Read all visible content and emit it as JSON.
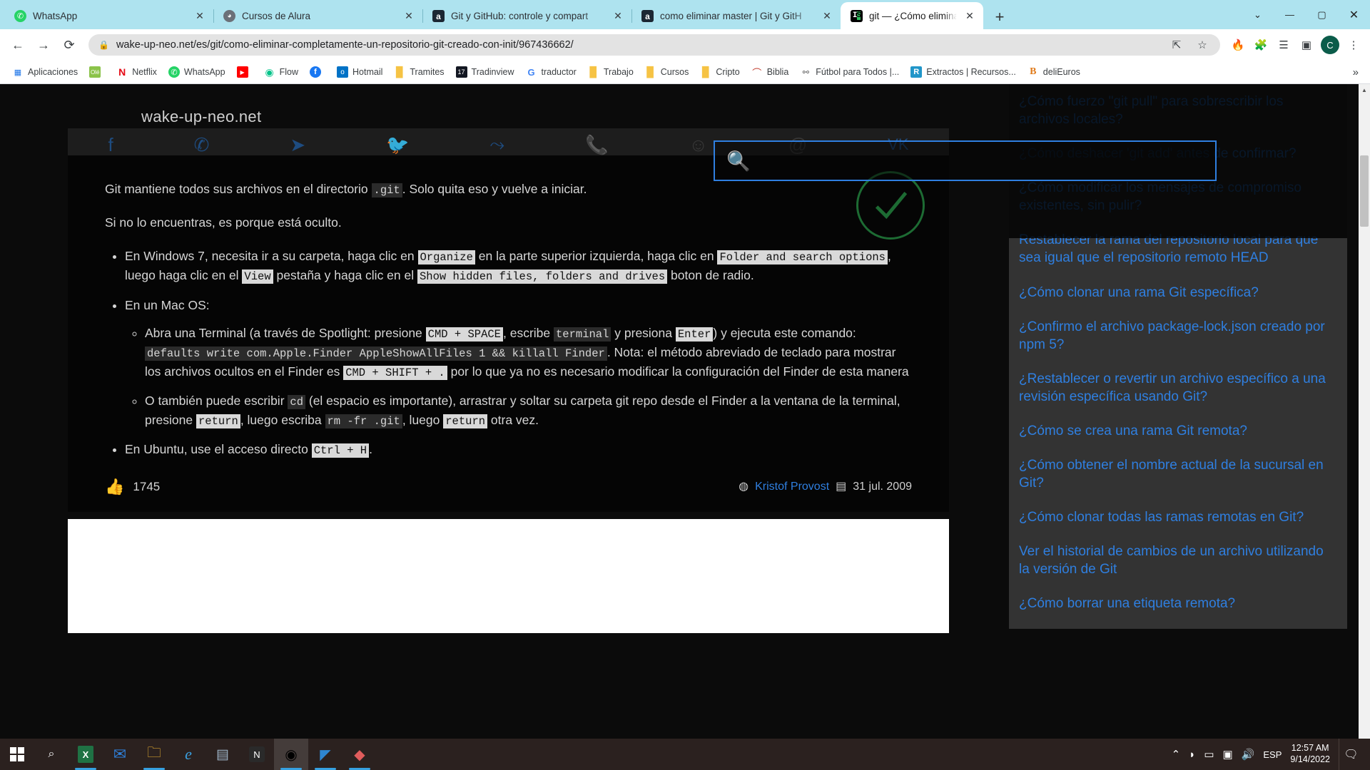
{
  "browser": {
    "tabs": [
      {
        "title": "WhatsApp",
        "favicon": "whatsapp-icon",
        "active": false
      },
      {
        "title": "Cursos de Alura",
        "favicon": "alura-icon",
        "active": false
      },
      {
        "title": "Git y GitHub: controle y compart",
        "favicon": "alura-a-icon",
        "active": false
      },
      {
        "title": "como eliminar master | Git y GitH",
        "favicon": "alura-a-icon",
        "active": false
      },
      {
        "title": "git — ¿Cómo eliminar completam",
        "favicon": "is-icon",
        "active": true
      }
    ],
    "new_tab_label": "+",
    "close_label": "✕",
    "window_controls": {
      "list": "⌄",
      "minimize": "—",
      "maximize": "▢",
      "close": "✕"
    },
    "nav": {
      "back": "←",
      "forward": "→",
      "reload": "⟳"
    },
    "omnibox": {
      "lock_icon": "lock-icon",
      "url": "wake-up-neo.net/es/git/como-eliminar-completamente-un-repositorio-git-creado-con-init/967436662/",
      "share_icon": "share-icon",
      "bookmark_icon": "star-icon"
    },
    "toolbar_icons": [
      {
        "name": "flame-extension-icon",
        "glyph": "🔥"
      },
      {
        "name": "extensions-puzzle-icon",
        "glyph": "🧩"
      },
      {
        "name": "reading-list-icon",
        "glyph": "☰♪"
      },
      {
        "name": "side-panel-icon",
        "glyph": "▣"
      }
    ],
    "profile_initial": "C",
    "menu_icon": "⋮",
    "bookmarks": [
      {
        "label": "Aplicaciones",
        "icon": "apps-grid-icon"
      },
      {
        "label": "",
        "icon": "ole-icon"
      },
      {
        "label": "Netflix",
        "icon": "netflix-icon"
      },
      {
        "label": "WhatsApp",
        "icon": "whatsapp-icon"
      },
      {
        "label": "",
        "icon": "youtube-icon"
      },
      {
        "label": "Flow",
        "icon": "flow-icon"
      },
      {
        "label": "",
        "icon": "facebook-icon"
      },
      {
        "label": "Hotmail",
        "icon": "outlook-icon"
      },
      {
        "label": "Tramites",
        "icon": "folder-icon"
      },
      {
        "label": "Tradinview",
        "icon": "tradingview-icon"
      },
      {
        "label": "traductor",
        "icon": "google-icon"
      },
      {
        "label": "Trabajo",
        "icon": "folder-icon"
      },
      {
        "label": "Cursos",
        "icon": "folder-icon"
      },
      {
        "label": "Cripto",
        "icon": "folder-icon"
      },
      {
        "label": "Biblia",
        "icon": "biblia-icon"
      },
      {
        "label": "Fútbol para Todos |...",
        "icon": "link-icon"
      },
      {
        "label": "Extractos | Recursos...",
        "icon": "r-icon"
      },
      {
        "label": "deliEuros",
        "icon": "b-icon"
      }
    ],
    "bookmarks_overflow": "»"
  },
  "site": {
    "brand": "wake-up-neo.net",
    "social": [
      {
        "name": "facebook-share-icon",
        "glyph": "f"
      },
      {
        "name": "whatsapp-share-icon",
        "glyph": "✆"
      },
      {
        "name": "telegram-share-icon",
        "glyph": "➤"
      },
      {
        "name": "twitter-share-icon",
        "glyph": "🐦"
      },
      {
        "name": "share-nodes-icon",
        "glyph": "⤳"
      },
      {
        "name": "viber-share-icon",
        "glyph": "📞"
      },
      {
        "name": "odnoklassniki-share-icon",
        "glyph": "☺"
      },
      {
        "name": "email-share-icon",
        "glyph": "@"
      },
      {
        "name": "vk-share-icon",
        "glyph": "VK"
      }
    ],
    "search": {
      "icon": "search-magnifier-icon",
      "value": "",
      "placeholder": ""
    }
  },
  "article": {
    "intro": "Git mantiene todos sus archivos en el directorio .git. Solo quita eso y vuelve a iniciar.",
    "intro_parts": {
      "a": "Git mantiene todos sus archivos en el directorio ",
      "code": ".git",
      "b": ". Solo quita eso y vuelve a iniciar."
    },
    "second_line": "Si no lo encuentras, es porque está oculto.",
    "windows_item": {
      "p1": "En Windows 7, necesita ir a su carpeta, haga clic en ",
      "c1": "Organize",
      "p2": " en la parte superior izquierda, haga clic en ",
      "c2": "Folder and search options",
      "p3": ", luego haga clic en el ",
      "c3": "View",
      "p4": " pestaña y haga clic en el ",
      "c4": "Show hidden files, folders and drives",
      "p5": " boton de radio."
    },
    "mac_item": "En un Mac OS:",
    "mac_sub1": {
      "p1": "Abra una Terminal (a través de Spotlight: presione ",
      "c1": "CMD + SPACE",
      "p2": ", escribe ",
      "c2": "terminal",
      "p3": " y presiona ",
      "c3": "Enter",
      "p4": ") y ejecuta este comando: ",
      "c4": "defaults write com.Apple.Finder AppleShowAllFiles 1 && killall Finder",
      "p5": ". Nota: el método abreviado de teclado para mostrar los archivos ocultos en el Finder es ",
      "c5": "CMD + SHIFT + .",
      "p6": " por lo que ya no es necesario modificar la configuración del Finder de esta manera"
    },
    "mac_sub2": {
      "p1": "O también puede escribir ",
      "c1": "cd",
      "p2": " (el espacio es importante), arrastrar y soltar su carpeta git repo desde el Finder a la ventana de la terminal, presione ",
      "c2": "return",
      "p3": ", luego escriba ",
      "c3": "rm -fr .git",
      "p4": ", luego ",
      "c4": "return",
      "p5": " otra vez."
    },
    "ubuntu_item": {
      "p1": "En Ubuntu, use el acceso directo ",
      "c1": "Ctrl + H",
      "p2": "."
    },
    "accepted_icon": "check-circle-icon",
    "votes": "1745",
    "vote_icon": "thumbs-up-icon",
    "author_icon": "user-icon",
    "author": "Kristof Provost",
    "date_icon": "calendar-icon",
    "date": "31 jul. 2009"
  },
  "sidebar": {
    "links": [
      "¿Cómo fuerzo \"git pull\" para sobrescribir los archivos locales?",
      "¿Cómo deshacer 'git add' antes de confirmar?",
      "¿Cómo modificar los mensajes de compromiso existentes, sin pulir?",
      "Restablecer la rama del repositorio local para que sea igual que el repositorio remoto HEAD",
      "¿Cómo clonar una rama Git específica?",
      "¿Confirmo el archivo package-lock.json creado por npm 5?",
      "¿Restablecer o revertir un archivo específico a una revisión específica usando Git?",
      "¿Cómo se crea una rama Git remota?",
      "¿Cómo obtener el nombre actual de la sucursal en Git?",
      "¿Cómo clonar todas las ramas remotas en Git?",
      "Ver el historial de cambios de un archivo utilizando la versión de Git",
      "¿Cómo borrar una etiqueta remota?"
    ]
  },
  "taskbar": {
    "items": [
      {
        "name": "start-button",
        "glyph": "⊞"
      },
      {
        "name": "search-taskbar-icon",
        "glyph": "🔍"
      },
      {
        "name": "excel-icon",
        "glyph": "X"
      },
      {
        "name": "mail-icon",
        "glyph": "✉"
      },
      {
        "name": "file-explorer-icon",
        "glyph": "🗂"
      },
      {
        "name": "internet-explorer-icon",
        "glyph": "e"
      },
      {
        "name": "calculator-icon",
        "glyph": "▦"
      },
      {
        "name": "notion-icon",
        "glyph": "N"
      },
      {
        "name": "chrome-icon",
        "glyph": "◉"
      },
      {
        "name": "vscode-icon",
        "glyph": "✕"
      },
      {
        "name": "app-diamond-icon",
        "glyph": "◆"
      }
    ],
    "tray": {
      "chevron": "⌃",
      "wifi_icon": "wifi-icon",
      "battery_icon": "battery-charging-icon",
      "sync_icon": "onedrive-sync-icon",
      "volume_icon": "volume-icon",
      "language": "ESP",
      "time": "12:57 AM",
      "date": "9/14/2022",
      "notification_icon": "notification-icon"
    }
  },
  "colors": {
    "tab_strip": "#aee3ef",
    "link_blue": "#2f7fe0",
    "accent_green": "#2aa12a",
    "taskbar": "#2b211f"
  }
}
